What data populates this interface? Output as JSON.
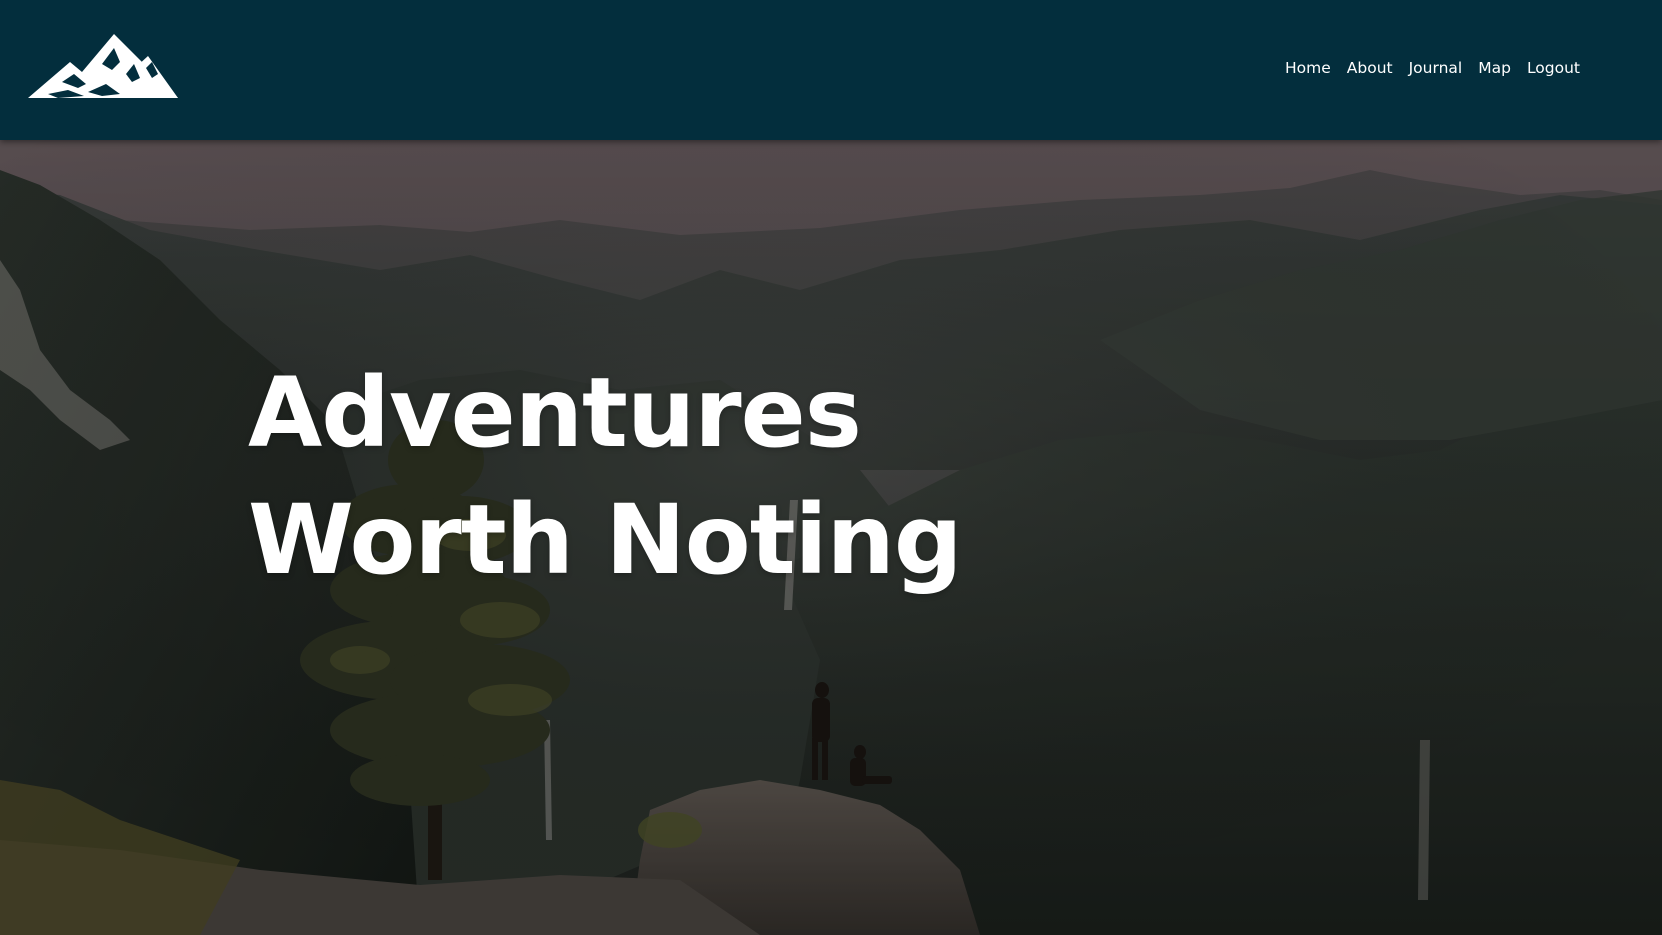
{
  "navbar": {
    "logo_icon": "mountain-logo-icon",
    "background": "#032e3d",
    "links": [
      {
        "label": "Home"
      },
      {
        "label": "About"
      },
      {
        "label": "Journal"
      },
      {
        "label": "Map"
      },
      {
        "label": "Logout"
      }
    ]
  },
  "hero": {
    "title": "Adventures Worth Noting",
    "image": "mountain-valley-photo"
  }
}
